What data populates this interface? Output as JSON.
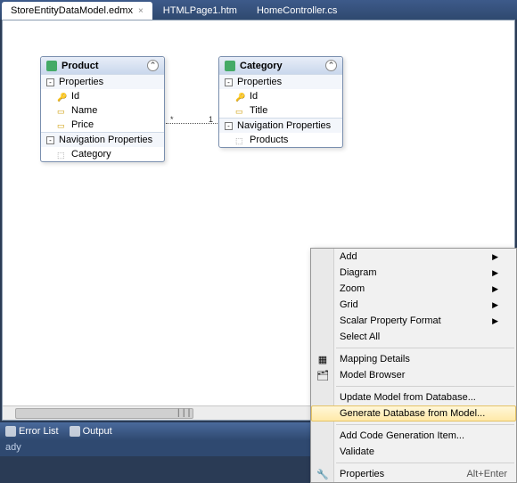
{
  "tabs": [
    {
      "label": "StoreEntityDataModel.edmx",
      "active": true
    },
    {
      "label": "HTMLPage1.htm",
      "active": false
    },
    {
      "label": "HomeController.cs",
      "active": false
    }
  ],
  "entities": {
    "product": {
      "title": "Product",
      "sections": {
        "properties": "Properties",
        "navigation": "Navigation Properties"
      },
      "props": [
        "Id",
        "Name",
        "Price"
      ],
      "navs": [
        "Category"
      ]
    },
    "category": {
      "title": "Category",
      "sections": {
        "properties": "Properties",
        "navigation": "Navigation Properties"
      },
      "props": [
        "Id",
        "Title"
      ],
      "navs": [
        "Products"
      ]
    }
  },
  "relation": {
    "left": "*",
    "right": "1"
  },
  "status": {
    "error_list": "Error List",
    "output": "Output",
    "ready": "ady"
  },
  "context_menu": {
    "add": "Add",
    "diagram": "Diagram",
    "zoom": "Zoom",
    "grid": "Grid",
    "scalar": "Scalar Property Format",
    "select_all": "Select All",
    "mapping": "Mapping Details",
    "browser": "Model Browser",
    "update": "Update Model from Database...",
    "generate": "Generate Database from Model...",
    "add_code": "Add Code Generation Item...",
    "validate": "Validate",
    "properties": "Properties",
    "properties_shortcut": "Alt+Enter"
  }
}
